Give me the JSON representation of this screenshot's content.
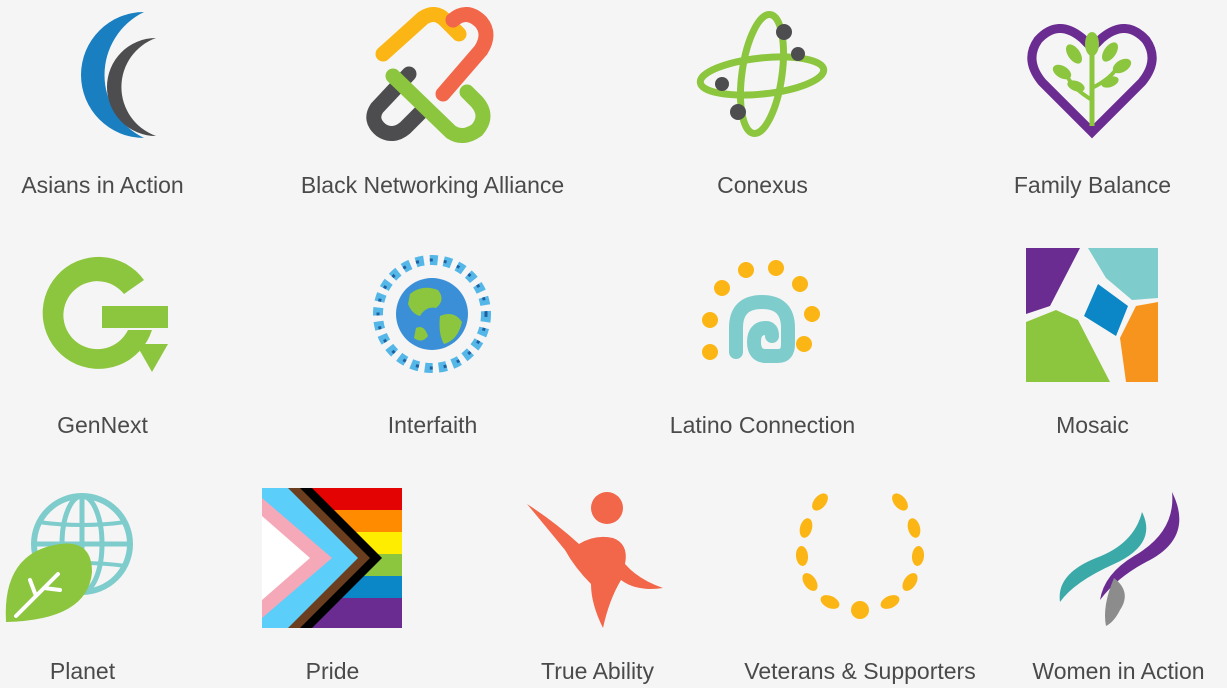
{
  "groups": {
    "asians": {
      "label": "Asians in Action",
      "icon": "crescent-moons-icon"
    },
    "black": {
      "label": "Black Networking Alliance",
      "icon": "interlocked-links-icon"
    },
    "conexus": {
      "label": "Conexus",
      "icon": "orbit-icon"
    },
    "family": {
      "label": "Family Balance",
      "icon": "heart-tree-icon"
    },
    "gennext": {
      "label": "GenNext",
      "icon": "g-arrow-icon"
    },
    "interfaith": {
      "label": "Interfaith",
      "icon": "globe-people-icon"
    },
    "latino": {
      "label": "Latino Connection",
      "icon": "sun-spiral-icon"
    },
    "mosaic": {
      "label": "Mosaic",
      "icon": "mosaic-tiles-icon"
    },
    "planet": {
      "label": "Planet",
      "icon": "leaf-globe-icon"
    },
    "pride": {
      "label": "Pride",
      "icon": "progress-flag-icon"
    },
    "ability": {
      "label": "True Ability",
      "icon": "jumping-figure-icon"
    },
    "veterans": {
      "label": "Veterans & Supporters",
      "icon": "laurel-wreath-icon"
    },
    "women": {
      "label": "Women in Action",
      "icon": "ribbon-flame-icon"
    }
  },
  "colors": {
    "blue": "#1a7fc1",
    "gray": "#4d4d4f",
    "green": "#8cc63f",
    "orange": "#f26649",
    "yellow": "#fbb616",
    "purple": "#6b2c91",
    "teal": "#7ecccc"
  }
}
